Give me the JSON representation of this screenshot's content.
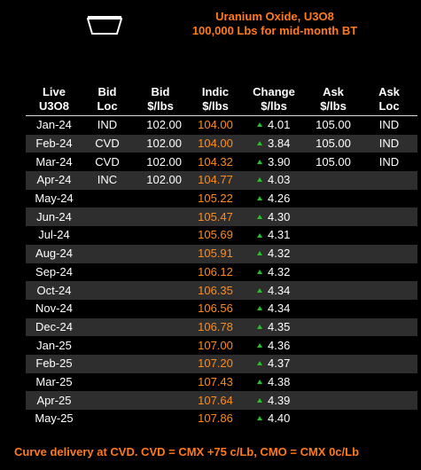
{
  "header": {
    "title_line1": "Uranium Oxide, U3O8",
    "title_line2": "100,000 Lbs for mid-month BT"
  },
  "icons": {
    "logo": "tray-logo-icon",
    "change_up": "up-triangle-icon"
  },
  "colors": {
    "accent_orange": "#ff7a1a",
    "indic_orange": "#ff8c1a",
    "up_green": "#26c226",
    "stripe": "#2e2e2e",
    "background": "#000000"
  },
  "table": {
    "columns": [
      {
        "line1": "Live",
        "line2": "U3O8"
      },
      {
        "line1": "Bid",
        "line2": "Loc"
      },
      {
        "line1": "Bid",
        "line2": "$/lbs"
      },
      {
        "line1": "Indic",
        "line2": "$/lbs"
      },
      {
        "line1": "Change",
        "line2": "$/lbs"
      },
      {
        "line1": "Ask",
        "line2": "$/lbs"
      },
      {
        "line1": "Ask",
        "line2": "Loc"
      }
    ],
    "rows": [
      {
        "live": "Jan-24",
        "bid_loc": "IND",
        "bid": "102.00",
        "indic": "104.00",
        "change_dir": "up",
        "change": "4.01",
        "ask": "105.00",
        "ask_loc": "IND"
      },
      {
        "live": "Feb-24",
        "bid_loc": "CVD",
        "bid": "102.00",
        "indic": "104.00",
        "change_dir": "up",
        "change": "3.84",
        "ask": "105.00",
        "ask_loc": "IND"
      },
      {
        "live": "Mar-24",
        "bid_loc": "CVD",
        "bid": "102.00",
        "indic": "104.32",
        "change_dir": "up",
        "change": "3.90",
        "ask": "105.00",
        "ask_loc": "IND"
      },
      {
        "live": "Apr-24",
        "bid_loc": "INC",
        "bid": "102.00",
        "indic": "104.77",
        "change_dir": "up",
        "change": "4.03",
        "ask": "",
        "ask_loc": ""
      },
      {
        "live": "May-24",
        "bid_loc": "",
        "bid": "",
        "indic": "105.22",
        "change_dir": "up",
        "change": "4.26",
        "ask": "",
        "ask_loc": ""
      },
      {
        "live": "Jun-24",
        "bid_loc": "",
        "bid": "",
        "indic": "105.47",
        "change_dir": "up",
        "change": "4.30",
        "ask": "",
        "ask_loc": ""
      },
      {
        "live": "Jul-24",
        "bid_loc": "",
        "bid": "",
        "indic": "105.69",
        "change_dir": "up",
        "change": "4.31",
        "ask": "",
        "ask_loc": ""
      },
      {
        "live": "Aug-24",
        "bid_loc": "",
        "bid": "",
        "indic": "105.91",
        "change_dir": "up",
        "change": "4.32",
        "ask": "",
        "ask_loc": ""
      },
      {
        "live": "Sep-24",
        "bid_loc": "",
        "bid": "",
        "indic": "106.12",
        "change_dir": "up",
        "change": "4.32",
        "ask": "",
        "ask_loc": ""
      },
      {
        "live": "Oct-24",
        "bid_loc": "",
        "bid": "",
        "indic": "106.35",
        "change_dir": "up",
        "change": "4.34",
        "ask": "",
        "ask_loc": ""
      },
      {
        "live": "Nov-24",
        "bid_loc": "",
        "bid": "",
        "indic": "106.56",
        "change_dir": "up",
        "change": "4.34",
        "ask": "",
        "ask_loc": ""
      },
      {
        "live": "Dec-24",
        "bid_loc": "",
        "bid": "",
        "indic": "106.78",
        "change_dir": "up",
        "change": "4.35",
        "ask": "",
        "ask_loc": ""
      },
      {
        "live": "Jan-25",
        "bid_loc": "",
        "bid": "",
        "indic": "107.00",
        "change_dir": "up",
        "change": "4.36",
        "ask": "",
        "ask_loc": ""
      },
      {
        "live": "Feb-25",
        "bid_loc": "",
        "bid": "",
        "indic": "107.20",
        "change_dir": "up",
        "change": "4.37",
        "ask": "",
        "ask_loc": ""
      },
      {
        "live": "Mar-25",
        "bid_loc": "",
        "bid": "",
        "indic": "107.43",
        "change_dir": "up",
        "change": "4.38",
        "ask": "",
        "ask_loc": ""
      },
      {
        "live": "Apr-25",
        "bid_loc": "",
        "bid": "",
        "indic": "107.64",
        "change_dir": "up",
        "change": "4.39",
        "ask": "",
        "ask_loc": ""
      },
      {
        "live": "May-25",
        "bid_loc": "",
        "bid": "",
        "indic": "107.86",
        "change_dir": "up",
        "change": "4.40",
        "ask": "",
        "ask_loc": ""
      }
    ]
  },
  "footer": {
    "note": "Curve delivery at CVD. CVD = CMX +75 c/Lb, CMO = CMX 0c/Lb"
  }
}
